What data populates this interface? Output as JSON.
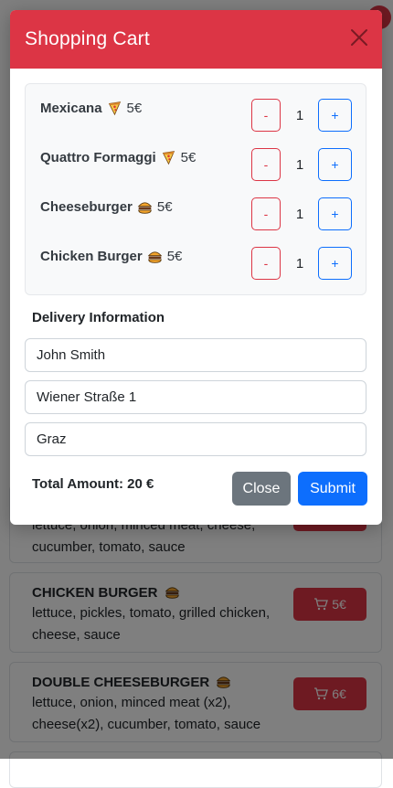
{
  "colors": {
    "primary_red": "#dc3545",
    "primary_blue": "#0d6efd",
    "secondary_gray": "#6c757d",
    "backdrop": "rgba(0,0,0,0.5)"
  },
  "modal": {
    "title": "Shopping Cart",
    "close_icon": "close-icon",
    "items": [
      {
        "name": "Mexicana",
        "emoji": "pizza-icon",
        "price": "5€",
        "quantity": "1",
        "minus_label": "-",
        "plus_label": "+"
      },
      {
        "name": "Quattro Formaggi",
        "emoji": "pizza-icon",
        "price": "5€",
        "quantity": "1",
        "minus_label": "-",
        "plus_label": "+"
      },
      {
        "name": "Cheeseburger",
        "emoji": "burger-icon",
        "price": "5€",
        "quantity": "1",
        "minus_label": "-",
        "plus_label": "+"
      },
      {
        "name": "Chicken Burger",
        "emoji": "burger-icon",
        "price": "5€",
        "quantity": "1",
        "minus_label": "-",
        "plus_label": "+"
      }
    ],
    "delivery": {
      "title": "Delivery Information",
      "name_value": "John Smith",
      "street_value": "Wiener Straße 1",
      "city_value": "Graz"
    },
    "total_text": "Total Amount: 20 €",
    "close_label": "Close",
    "submit_label": "Submit"
  },
  "background_menu": {
    "partial_desc": "lettuce, onion, minced meat, cheese, cucumber, tomato, sauce",
    "cards": [
      {
        "name": "CHICKEN BURGER",
        "emoji": "burger-icon",
        "desc": "lettuce, pickles, tomato, grilled chicken, cheese, sauce",
        "price": "5€"
      },
      {
        "name": "DOUBLE CHEESEBURGER",
        "emoji": "burger-icon",
        "desc": "lettuce, onion, minced meat (x2), cheese(x2), cucumber, tomato, sauce",
        "price": "6€"
      }
    ]
  }
}
